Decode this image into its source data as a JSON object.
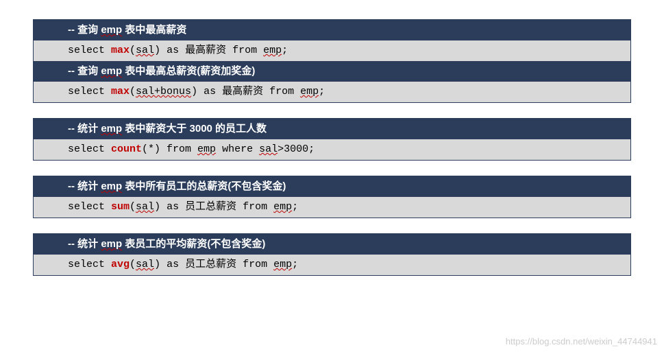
{
  "blocks": [
    {
      "rows": [
        {
          "type": "dark",
          "segments": [
            {
              "t": "plain",
              "v": "-- 查询 "
            },
            {
              "t": "emp",
              "v": "emp"
            },
            {
              "t": "plain",
              "v": " 表中最高薪资"
            }
          ]
        },
        {
          "type": "light",
          "segments": [
            {
              "t": "plain",
              "v": "select "
            },
            {
              "t": "kw",
              "v": "max"
            },
            {
              "t": "plain",
              "v": "("
            },
            {
              "t": "emp",
              "v": "sal"
            },
            {
              "t": "plain",
              "v": ") as 最高薪资 from "
            },
            {
              "t": "emp",
              "v": "emp"
            },
            {
              "t": "plain",
              "v": ";"
            }
          ]
        },
        {
          "type": "dark",
          "segments": [
            {
              "t": "plain",
              "v": "-- 查询 "
            },
            {
              "t": "emp",
              "v": "emp"
            },
            {
              "t": "plain",
              "v": " 表中最高总薪资(薪资加奖金)"
            }
          ]
        },
        {
          "type": "light",
          "segments": [
            {
              "t": "plain",
              "v": "select "
            },
            {
              "t": "kw",
              "v": "max"
            },
            {
              "t": "plain",
              "v": "("
            },
            {
              "t": "emp",
              "v": "sal+bonus"
            },
            {
              "t": "plain",
              "v": ") as 最高薪资 from "
            },
            {
              "t": "emp",
              "v": "emp"
            },
            {
              "t": "plain",
              "v": ";"
            }
          ]
        }
      ]
    },
    {
      "rows": [
        {
          "type": "dark",
          "segments": [
            {
              "t": "plain",
              "v": "-- 统计 "
            },
            {
              "t": "emp",
              "v": "emp"
            },
            {
              "t": "plain",
              "v": " 表中薪资大于 3000 的员工人数"
            }
          ]
        },
        {
          "type": "light",
          "segments": [
            {
              "t": "plain",
              "v": "select "
            },
            {
              "t": "kw",
              "v": "count"
            },
            {
              "t": "plain",
              "v": "(*) from "
            },
            {
              "t": "emp",
              "v": "emp"
            },
            {
              "t": "plain",
              "v": " where "
            },
            {
              "t": "emp",
              "v": "sal"
            },
            {
              "t": "plain",
              "v": ">3000;"
            }
          ]
        }
      ]
    },
    {
      "rows": [
        {
          "type": "dark",
          "segments": [
            {
              "t": "plain",
              "v": "-- 统计 "
            },
            {
              "t": "emp",
              "v": "emp"
            },
            {
              "t": "plain",
              "v": " 表中所有员工的总薪资(不包含奖金)"
            }
          ]
        },
        {
          "type": "light",
          "segments": [
            {
              "t": "plain",
              "v": "select "
            },
            {
              "t": "kw",
              "v": "sum"
            },
            {
              "t": "plain",
              "v": "("
            },
            {
              "t": "emp",
              "v": "sal"
            },
            {
              "t": "plain",
              "v": ") as 员工总薪资 from "
            },
            {
              "t": "emp",
              "v": "emp"
            },
            {
              "t": "plain",
              "v": ";"
            }
          ]
        }
      ]
    },
    {
      "rows": [
        {
          "type": "dark",
          "segments": [
            {
              "t": "plain",
              "v": "-- 统计 "
            },
            {
              "t": "emp",
              "v": "emp"
            },
            {
              "t": "plain",
              "v": " 表员工的平均薪资(不包含奖金)"
            }
          ]
        },
        {
          "type": "light",
          "segments": [
            {
              "t": "plain",
              "v": "select "
            },
            {
              "t": "kw",
              "v": "avg"
            },
            {
              "t": "plain",
              "v": "("
            },
            {
              "t": "emp",
              "v": "sal"
            },
            {
              "t": "plain",
              "v": ") as 员工总薪资 from "
            },
            {
              "t": "emp",
              "v": "emp"
            },
            {
              "t": "plain",
              "v": ";"
            }
          ]
        }
      ]
    }
  ],
  "watermark": "https://blog.csdn.net/weixin_44744941"
}
